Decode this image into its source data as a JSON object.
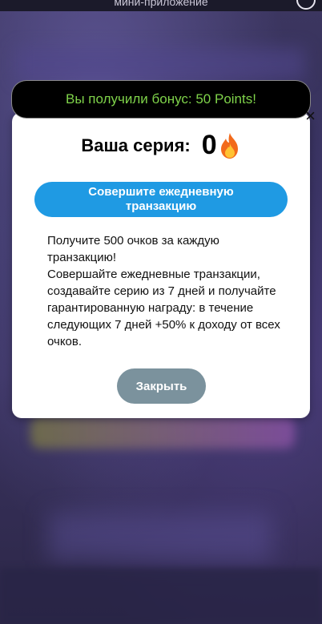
{
  "topbar": {
    "subtitle": "мини-приложение"
  },
  "toast": {
    "message": "Вы получили бонус: 50 Points!"
  },
  "modal": {
    "close_icon": "×",
    "streak_label": "Ваша серия:",
    "streak_value": "0",
    "streak_icon": "fire-icon",
    "cta_label": "Совершите ежедневную транзакцию",
    "description_line1": "Получите 500 очков за каждую транзакцию!",
    "description_line2": "Совершайте ежедневные транзакции, создавайте серию из 7 дней и получайте гарантированную награду: в течение следующих 7 дней +50% к доходу от всех очков.",
    "close_label": "Закрыть"
  },
  "colors": {
    "toast_text": "#7fd34a",
    "cta_bg": "#1f9ae3",
    "close_bg": "#7b929d"
  }
}
